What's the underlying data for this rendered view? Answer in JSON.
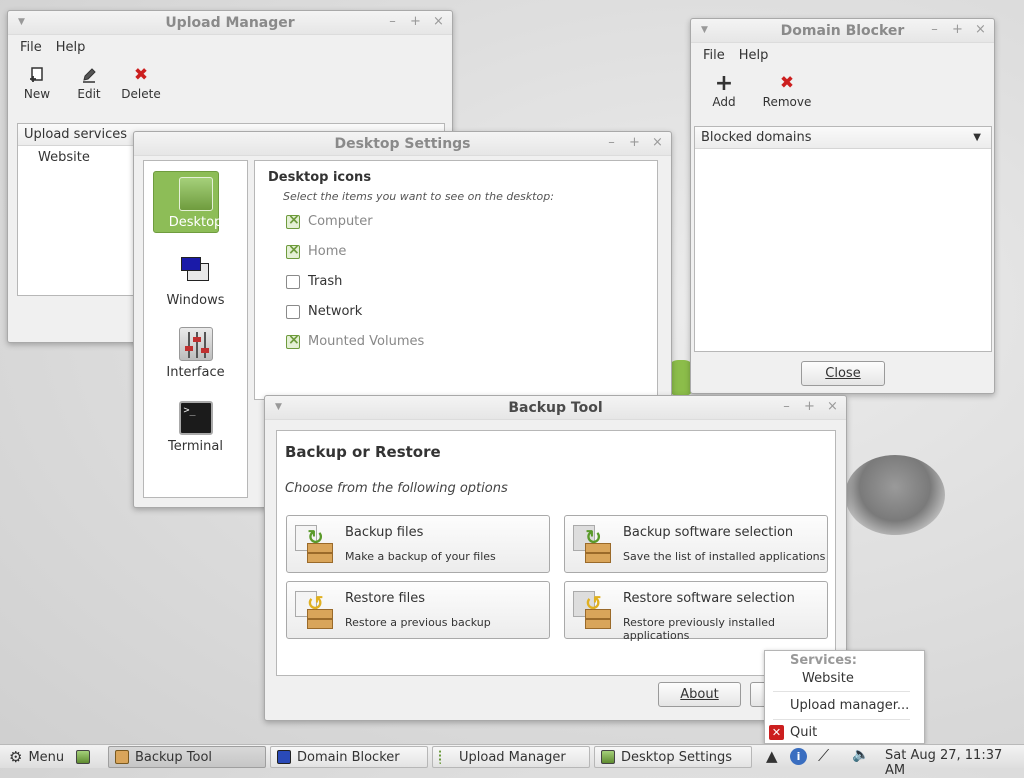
{
  "upload_manager": {
    "title": "Upload Manager",
    "menu": [
      "File",
      "Help"
    ],
    "toolbar": [
      {
        "label": "New",
        "icon": "new-icon"
      },
      {
        "label": "Edit",
        "icon": "pencil-icon"
      },
      {
        "label": "Delete",
        "icon": "red-x-icon"
      }
    ],
    "list_header": "Upload services",
    "items": [
      "Website"
    ]
  },
  "domain_blocker": {
    "title": "Domain Blocker",
    "menu": [
      "File",
      "Help"
    ],
    "toolbar": [
      {
        "label": "Add",
        "icon": "plus-icon"
      },
      {
        "label": "Remove",
        "icon": "red-x-icon"
      }
    ],
    "column_header": "Blocked domains",
    "close_label": "Close"
  },
  "desktop_settings": {
    "title": "Desktop Settings",
    "categories": [
      {
        "label": "Desktop",
        "icon": "desktop-icon",
        "selected": true
      },
      {
        "label": "Windows",
        "icon": "windows-icon"
      },
      {
        "label": "Interface",
        "icon": "sliders-icon"
      },
      {
        "label": "Terminal",
        "icon": "terminal-icon"
      }
    ],
    "section_title": "Desktop icons",
    "section_subtitle": "Select the items you want to see on the desktop:",
    "options": [
      {
        "label": "Computer",
        "checked": true
      },
      {
        "label": "Home",
        "checked": true
      },
      {
        "label": "Trash",
        "checked": false
      },
      {
        "label": "Network",
        "checked": false
      },
      {
        "label": "Mounted Volumes",
        "checked": true
      }
    ]
  },
  "backup_tool": {
    "title": "Backup Tool",
    "heading": "Backup or Restore",
    "subheading": "Choose from the following options",
    "buttons": [
      {
        "title": "Backup files",
        "subtitle": "Make a backup of your files",
        "icon": "backup-box-icon"
      },
      {
        "title": "Backup software selection",
        "subtitle": "Save the list of installed applications",
        "icon": "backup-box-icon"
      },
      {
        "title": "Restore files",
        "subtitle": "Restore a previous backup",
        "icon": "restore-box-icon"
      },
      {
        "title": "Restore software selection",
        "subtitle": "Restore previously installed applications",
        "icon": "restore-box-icon"
      }
    ],
    "about_label": "About"
  },
  "tray_popup": {
    "section_label": "Services:",
    "service_item": "Website",
    "upload_manager_item": "Upload manager...",
    "quit_item": "Quit"
  },
  "taskbar": {
    "menu_label": "Menu",
    "windows": [
      "Backup Tool",
      "Domain Blocker",
      "Upload Manager",
      "Desktop Settings"
    ],
    "active_window": "Backup Tool",
    "clock": "Sat Aug 27, 11:37 AM"
  },
  "colors": {
    "accent_green": "#8dbd57",
    "danger_red": "#cc1f1f"
  }
}
